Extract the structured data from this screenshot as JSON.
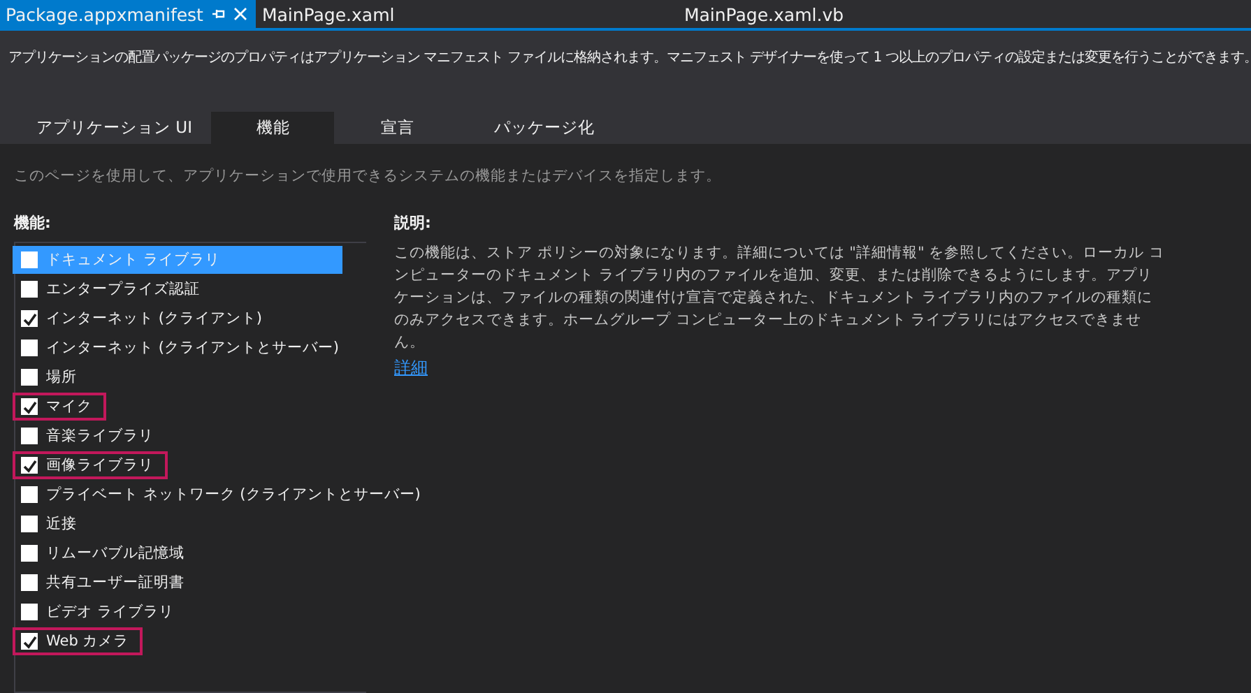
{
  "doc_tabs": [
    {
      "label": "Package.appxmanifest",
      "selected": true,
      "pinned": true
    },
    {
      "label": "MainPage.xaml",
      "selected": false,
      "pinned": false
    },
    {
      "label": "MainPage.xaml.vb",
      "selected": false,
      "pinned": false
    }
  ],
  "header_text": "アプリケーションの配置パッケージのプロパティはアプリケーション マニフェスト ファイルに格納されます。マニフェスト デザイナーを使って 1 つ以上のプロパティの設定または変更を行うことができます。",
  "tabs": [
    {
      "label": "アプリケーション UI",
      "selected": false
    },
    {
      "label": "機能",
      "selected": true
    },
    {
      "label": "宣言",
      "selected": false
    },
    {
      "label": "パッケージ化",
      "selected": false
    }
  ],
  "page_hint": "このページを使用して、アプリケーションで使用できるシステムの機能またはデバイスを指定します。",
  "capabilities": {
    "heading": "機能:",
    "items": [
      {
        "label": "ドキュメント ライブラリ",
        "checked": false,
        "selected": true,
        "highlighted": false
      },
      {
        "label": "エンタープライズ認証",
        "checked": false,
        "selected": false,
        "highlighted": false
      },
      {
        "label": "インターネット (クライアント)",
        "checked": true,
        "selected": false,
        "highlighted": false
      },
      {
        "label": "インターネット (クライアントとサーバー)",
        "checked": false,
        "selected": false,
        "highlighted": false
      },
      {
        "label": "場所",
        "checked": false,
        "selected": false,
        "highlighted": false
      },
      {
        "label": "マイク",
        "checked": true,
        "selected": false,
        "highlighted": true
      },
      {
        "label": "音楽ライブラリ",
        "checked": false,
        "selected": false,
        "highlighted": false
      },
      {
        "label": "画像ライブラリ",
        "checked": true,
        "selected": false,
        "highlighted": true
      },
      {
        "label": "プライベート ネットワーク (クライアントとサーバー)",
        "checked": false,
        "selected": false,
        "highlighted": false
      },
      {
        "label": "近接",
        "checked": false,
        "selected": false,
        "highlighted": false
      },
      {
        "label": "リムーバブル記憶域",
        "checked": false,
        "selected": false,
        "highlighted": false
      },
      {
        "label": "共有ユーザー証明書",
        "checked": false,
        "selected": false,
        "highlighted": false
      },
      {
        "label": "ビデオ ライブラリ",
        "checked": false,
        "selected": false,
        "highlighted": false
      },
      {
        "label": "Web カメラ",
        "checked": true,
        "selected": false,
        "highlighted": true
      }
    ]
  },
  "description": {
    "heading": "説明:",
    "text": "この機能は、ストア ポリシーの対象になります。詳細については \"詳細情報\" を参照してください。ローカル コンピューターのドキュメント ライブラリ内のファイルを追加、変更、または削除できるようにします。アプリケーションは、ファイルの種類の関連付け宣言で定義された、ドキュメント ライブラリ内のファイルの種類にのみアクセスできます。ホームグループ コンピューター上のドキュメント ライブラリにはアクセスできません。",
    "link": "詳細"
  }
}
